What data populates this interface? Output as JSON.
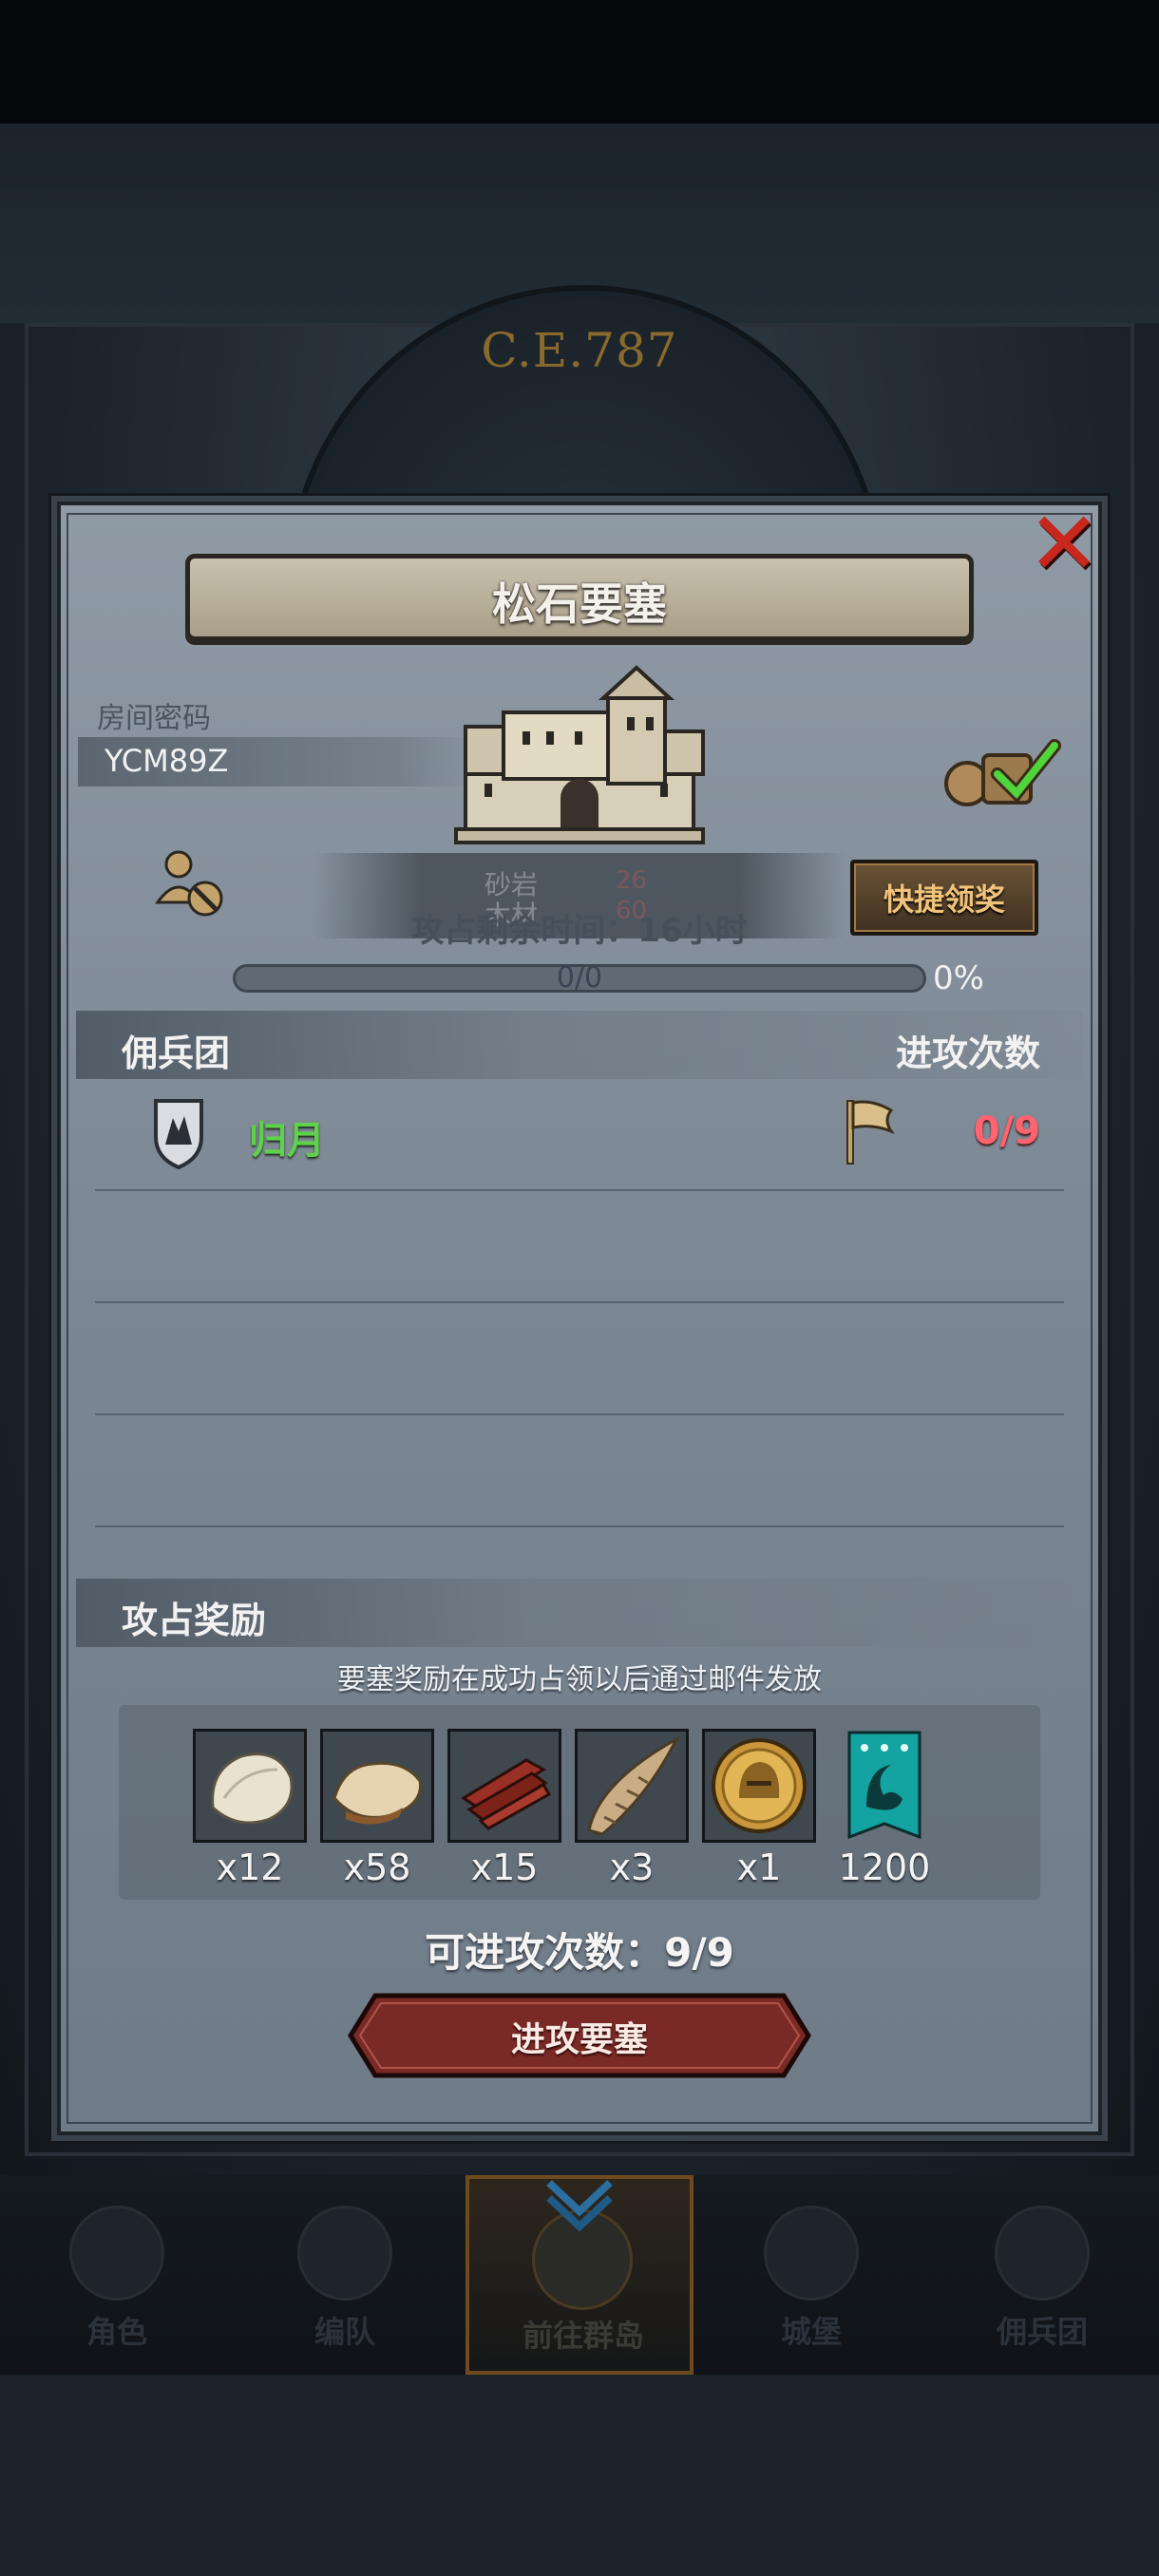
{
  "background": {
    "year": "C.E.787"
  },
  "dialog": {
    "title": "松石要塞",
    "close_icon": "close-x-icon",
    "room": {
      "label": "房间密码",
      "code": "YCM89Z"
    },
    "resources_ghost": [
      {
        "name": "砂岩",
        "value": "26"
      },
      {
        "name": "木材",
        "value": "60"
      }
    ],
    "timer_text": "攻占剩余时间：16小时",
    "claim_button": "快捷领奖",
    "progress": {
      "text": "0/0",
      "percent_label": "0%",
      "fraction": 0
    },
    "merc_section": {
      "left_label": "佣兵团",
      "right_label": "进攻次数"
    },
    "guilds": [
      {
        "name": "归月",
        "attacks": "0/9"
      }
    ],
    "reward_section": {
      "label": "攻占奖励",
      "note": "要塞奖励在成功占领以后通过邮件发放",
      "items": [
        {
          "icon": "pelt-white-icon",
          "qty": "x12"
        },
        {
          "icon": "pelt-tan-icon",
          "qty": "x58"
        },
        {
          "icon": "wood-planks-icon",
          "qty": "x15"
        },
        {
          "icon": "horn-icon",
          "qty": "x3"
        },
        {
          "icon": "gold-helmet-coin-icon",
          "qty": "x1"
        },
        {
          "icon": "teal-banner-icon",
          "qty": "1200"
        }
      ]
    },
    "attempts_text": "可进攻次数：9/9",
    "attack_button": "进攻要塞"
  },
  "nav": {
    "items": [
      {
        "label": "角色",
        "icon": "character-icon"
      },
      {
        "label": "编队",
        "icon": "formation-icon"
      },
      {
        "label": "前往群岛",
        "icon": "world-map-icon"
      },
      {
        "label": "城堡",
        "icon": "castle-icon"
      },
      {
        "label": "佣兵团",
        "icon": "mercenary-icon"
      }
    ],
    "active_index": 2
  },
  "colors": {
    "title_banner": "#b8af9b",
    "guild_name": "#5fd24d",
    "attack_count": "#ff6470",
    "claim_text": "#f0c27a",
    "close": "#c8271d"
  }
}
